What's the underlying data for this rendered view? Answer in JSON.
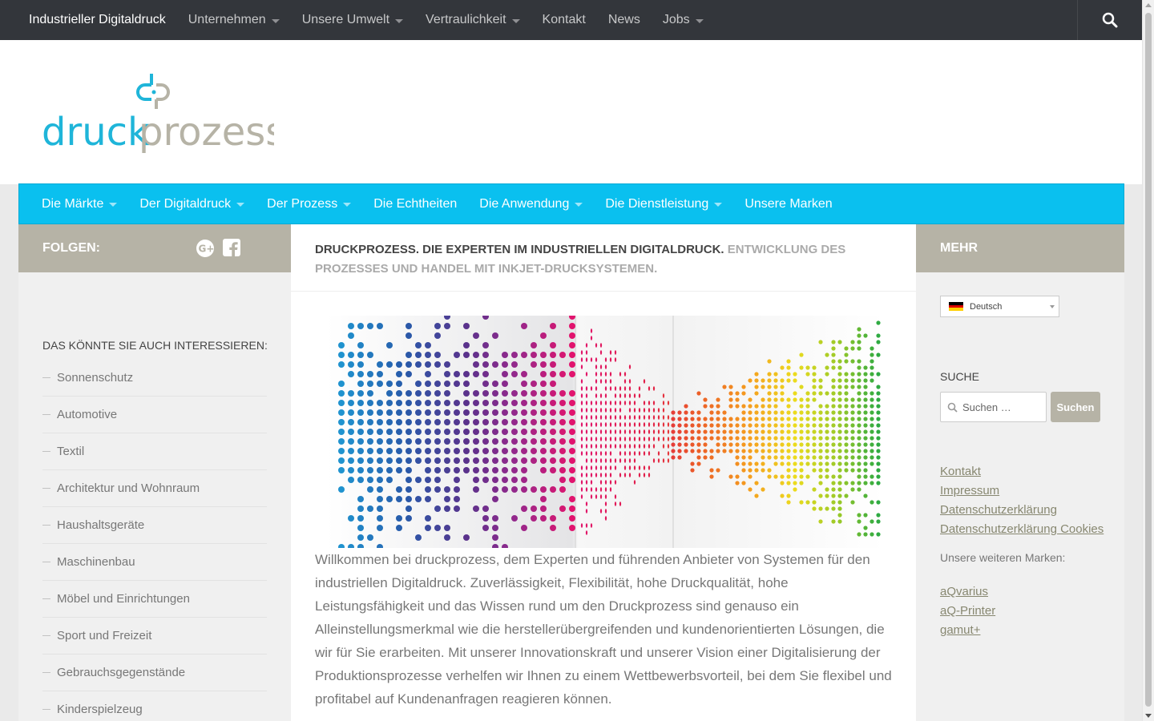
{
  "topbar": {
    "items": [
      {
        "label": "Industrieller Digitaldruck",
        "dropdown": false
      },
      {
        "label": "Unternehmen",
        "dropdown": true
      },
      {
        "label": "Unsere Umwelt",
        "dropdown": true
      },
      {
        "label": "Vertraulichkeit",
        "dropdown": true
      },
      {
        "label": "Kontakt",
        "dropdown": false
      },
      {
        "label": "News",
        "dropdown": false
      },
      {
        "label": "Jobs",
        "dropdown": true
      }
    ],
    "search_icon": "search-icon"
  },
  "header": {
    "logo_text_left": "druck",
    "logo_text_right": "prozess",
    "logo_colors": {
      "blue": "#1fb5d9",
      "gray": "#b6b3a6"
    }
  },
  "mainnav": {
    "items": [
      {
        "label": "Die Märkte",
        "dropdown": true
      },
      {
        "label": "Der Digitaldruck",
        "dropdown": true
      },
      {
        "label": "Der Prozess",
        "dropdown": true
      },
      {
        "label": "Die Echtheiten",
        "dropdown": false
      },
      {
        "label": "Die Anwendung",
        "dropdown": true
      },
      {
        "label": "Die Dienstleistung",
        "dropdown": true
      },
      {
        "label": "Unsere Marken",
        "dropdown": false
      }
    ]
  },
  "left_sidebar": {
    "heading": "FOLGEN:",
    "social_icons": [
      "google-plus-icon",
      "facebook-icon"
    ],
    "widget_title": "DAS KÖNNTE SIE AUCH INTERESSIEREN:",
    "items": [
      "Sonnenschutz",
      "Automotive",
      "Textil",
      "Architektur und Wohnraum",
      "Haushaltsgeräte",
      "Maschinenbau",
      "Möbel und Einrichtungen",
      "Sport und Freizeit",
      "Gebrauchsgegenstände",
      "Kinderspielzeug"
    ]
  },
  "main": {
    "tagline_strong": "DRUCKPROZESS. DIE EXPERTEN IM INDUSTRIELLEN DIGITALDRUCK.",
    "tagline_light": "ENTWICKLUNG DES PROZESSES UND HANDEL MIT INKJET-DRUCKSYSTEMEN.",
    "intro": "Willkommen bei druckprozess, dem Experten und führenden Anbieter von Systemen für den industriellen Digitaldruck. Zuverlässigkeit, Flexibilität, hohe Druckqualität, hohe Leistungsfähigkeit und das Wissen rund um den Druckprozess sind genauso ein Alleinstellungsmerkmal wie die herstellerübergreifenden und kundenorientierten Lösungen, die wir für Sie erarbeiten. Mit unserer Innovationskraft und unserer Vision einer Digitalisierung der Produktionsprozesse verhelfen wir Ihnen zu einem  Wettbewerbsvorteil, bei dem Sie flexibel und profitabel auf Kundenanfragen reagieren können."
  },
  "right_sidebar": {
    "heading": "MEHR",
    "language": "Deutsch",
    "search_title": "SUCHE",
    "search_placeholder": "Suchen …",
    "search_button": "Suchen",
    "links": [
      "Kontakt",
      "Impressum",
      "Datenschutzerklärung",
      "Datenschutzerklärung Cookies"
    ],
    "brands_label": "Unsere weiteren Marken:",
    "brands": [
      "aQvarius",
      "aQ-Printer",
      "gamut+"
    ]
  }
}
